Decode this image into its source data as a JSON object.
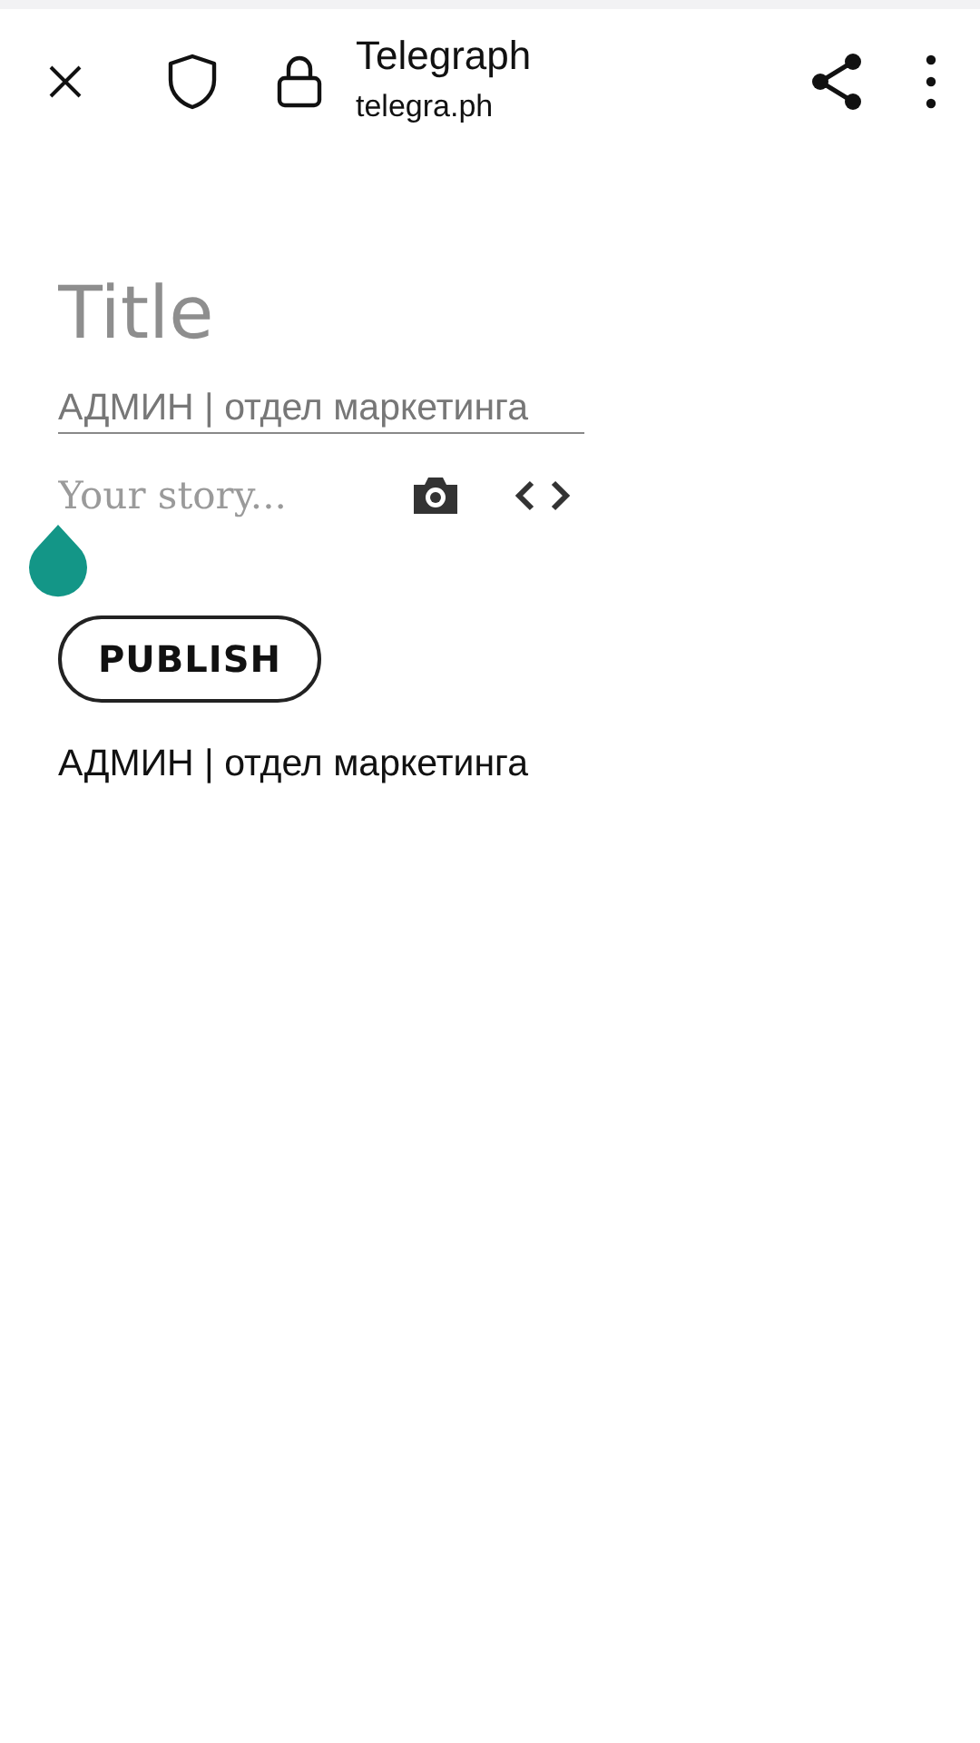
{
  "browser_bar": {
    "page_title": "Telegraph",
    "url": "telegra.ph"
  },
  "editor": {
    "title": {
      "placeholder": "Title"
    },
    "author": {
      "value": "АДМИН | отдел маркетинга"
    },
    "story": {
      "placeholder": "Your story..."
    }
  },
  "publish_button": "PUBLISH",
  "author_line": "АДМИН | отдел маркетинга"
}
